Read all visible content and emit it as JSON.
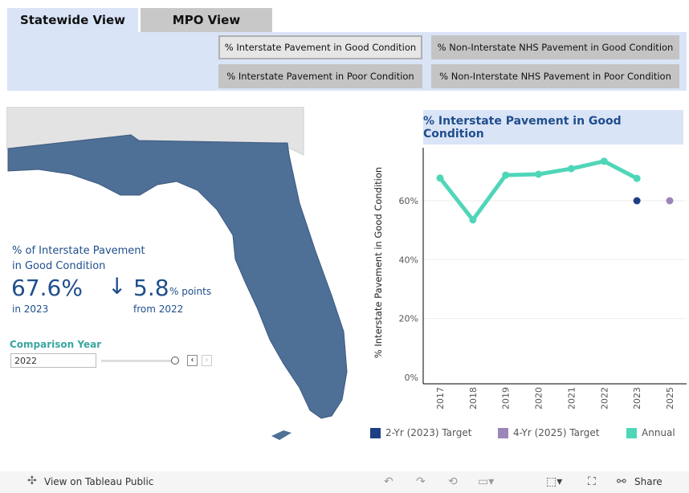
{
  "tabs": [
    {
      "label": "Statewide View",
      "active": true
    },
    {
      "label": "MPO View",
      "active": false
    }
  ],
  "measures": [
    {
      "label": "% Interstate Pavement in Good Condition",
      "selected": true
    },
    {
      "label": "% Non-Interstate NHS Pavement in Good Condition",
      "selected": false
    },
    {
      "label": "% Interstate Pavement in Poor Condition",
      "selected": false
    },
    {
      "label": "% Non-Interstate NHS Pavement in Poor Condition",
      "selected": false
    }
  ],
  "kpi": {
    "title_line1": "% of Interstate Pavement",
    "title_line2": "in Good Condition",
    "value": "67.6%",
    "year_label": "in 2023",
    "change_icon": "arrow-down-icon",
    "change_value": "5.8",
    "change_unit": "% points",
    "change_from": "from 2022"
  },
  "comparison": {
    "label": "Comparison Year",
    "value": "2022"
  },
  "colors": {
    "annual": "#4fd6b8",
    "target2": "#1f3f85",
    "target4": "#9b86b8",
    "map": "#4e6f96",
    "accent": "#1f4e8c"
  },
  "chart_data": {
    "type": "line",
    "title": "% Interstate Pavement in Good Condition",
    "ylabel": "% Interstate Pavement in Good Condition",
    "categories": [
      "2017",
      "2018",
      "2019",
      "2020",
      "2021",
      "2022",
      "2023",
      "2025"
    ],
    "yticks": [
      "0%",
      "20%",
      "40%",
      "60%"
    ],
    "ylim": [
      0,
      78
    ],
    "grid": true,
    "series": [
      {
        "name": "Annual",
        "type": "line",
        "values": [
          67.7,
          53.5,
          68.7,
          69.0,
          70.9,
          73.4,
          67.6,
          null
        ]
      },
      {
        "name": "2-Yr (2023) Target",
        "type": "point",
        "values": [
          null,
          null,
          null,
          null,
          null,
          null,
          60,
          null
        ]
      },
      {
        "name": "4-Yr (2025) Target",
        "type": "point",
        "values": [
          null,
          null,
          null,
          null,
          null,
          null,
          null,
          60
        ]
      }
    ],
    "legend_position": "bottom"
  },
  "legend": [
    "2-Yr (2023) Target",
    "4-Yr (2025) Target",
    "Annual"
  ],
  "footer": {
    "view_label": "View on Tableau Public",
    "share_label": "Share"
  }
}
